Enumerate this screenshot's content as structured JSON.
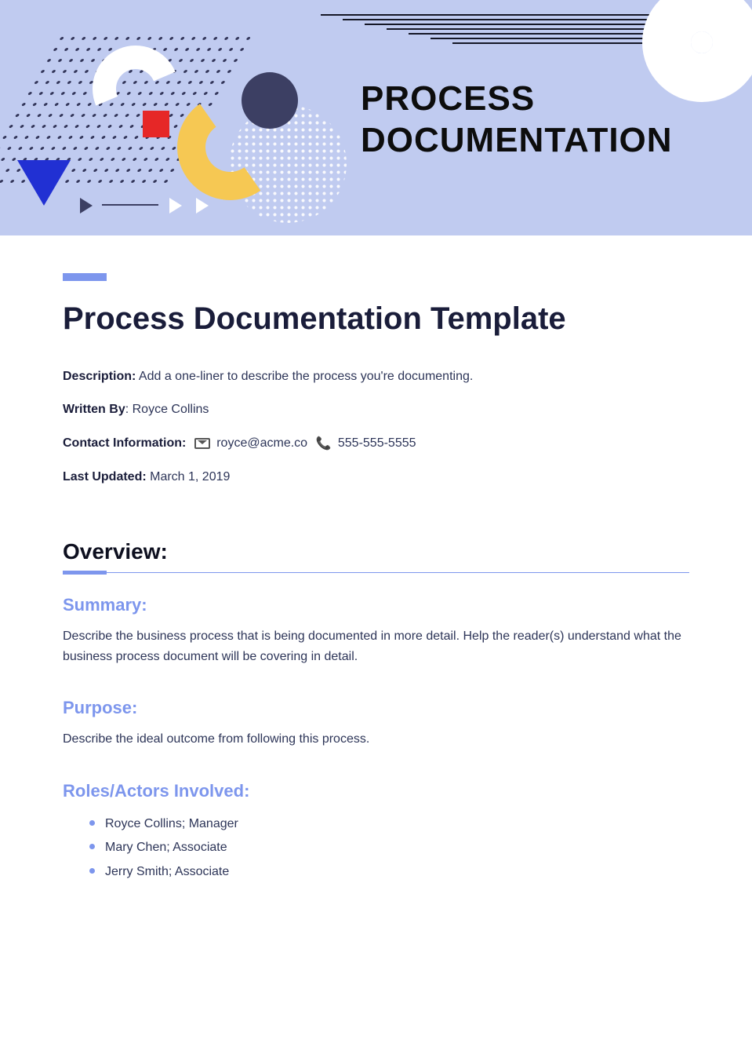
{
  "banner": {
    "title": "PROCESS\nDOCUMENTATION"
  },
  "page": {
    "title": "Process Documentation Template"
  },
  "meta": {
    "descriptionLabel": "Description:",
    "descriptionText": " Add a one-liner to describe the process you're documenting.",
    "writtenByLabel": "Written By",
    "writtenByText": ": Royce Collins",
    "contactLabel": "Contact Information:",
    "email": " royce@acme.co ",
    "phone": " 555-555-5555",
    "lastUpdatedLabel": "Last Updated:",
    "lastUpdatedText": " March 1, 2019"
  },
  "overview": {
    "heading": "Overview:",
    "summary": {
      "heading": "Summary:",
      "text": "Describe the business process that is being documented in more detail. Help the reader(s) understand what the business process document will be covering in detail."
    },
    "purpose": {
      "heading": "Purpose:",
      "text": "Describe the ideal outcome from following this process."
    },
    "roles": {
      "heading": "Roles/Actors Involved:",
      "items": [
        "Royce Collins; Manager",
        "Mary Chen; Associate",
        "Jerry Smith; Associate"
      ]
    }
  }
}
